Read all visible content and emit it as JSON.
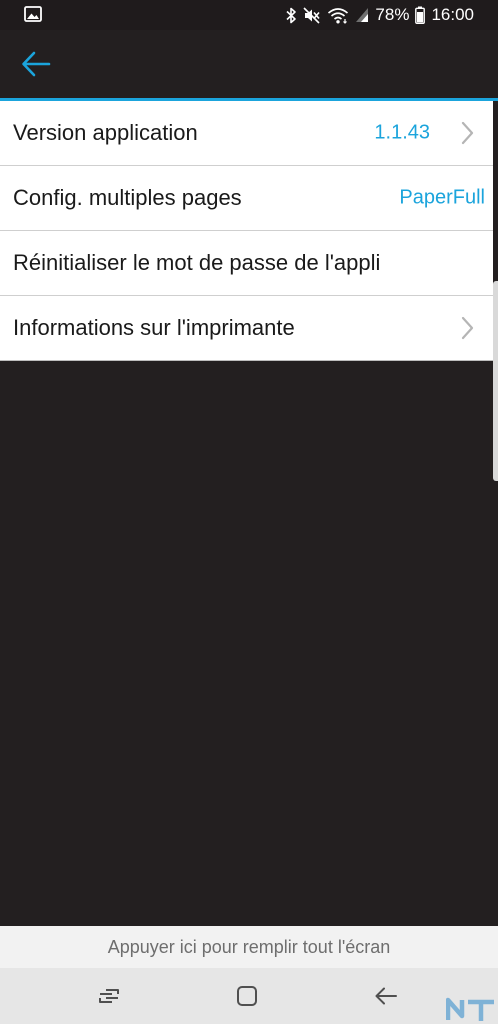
{
  "status_bar": {
    "battery": "78%",
    "time": "16:00",
    "icons": [
      "image-icon",
      "bluetooth-icon",
      "mute-icon",
      "wifi-icon",
      "signal-icon",
      "battery-icon"
    ]
  },
  "app_bar": {
    "back_icon": "arrow-left-icon",
    "accent_color": "#1ba4dc"
  },
  "settings": {
    "items": [
      {
        "label": "Version application",
        "value": "1.1.43",
        "chevron": true
      },
      {
        "label": "Config. multiples pages",
        "value": "PaperFull",
        "chevron": false
      },
      {
        "label": "Réinitialiser le mot de passe de l'appli",
        "value": "",
        "chevron": false
      },
      {
        "label": "Informations sur l'imprimante",
        "value": "",
        "chevron": true
      }
    ]
  },
  "fullscreen_hint": {
    "text": "Appuyer ici pour remplir tout l'écran"
  },
  "nav_bar": {
    "buttons": [
      "recents-icon",
      "home-icon",
      "back-icon"
    ]
  },
  "watermark": {
    "text": "NT"
  }
}
